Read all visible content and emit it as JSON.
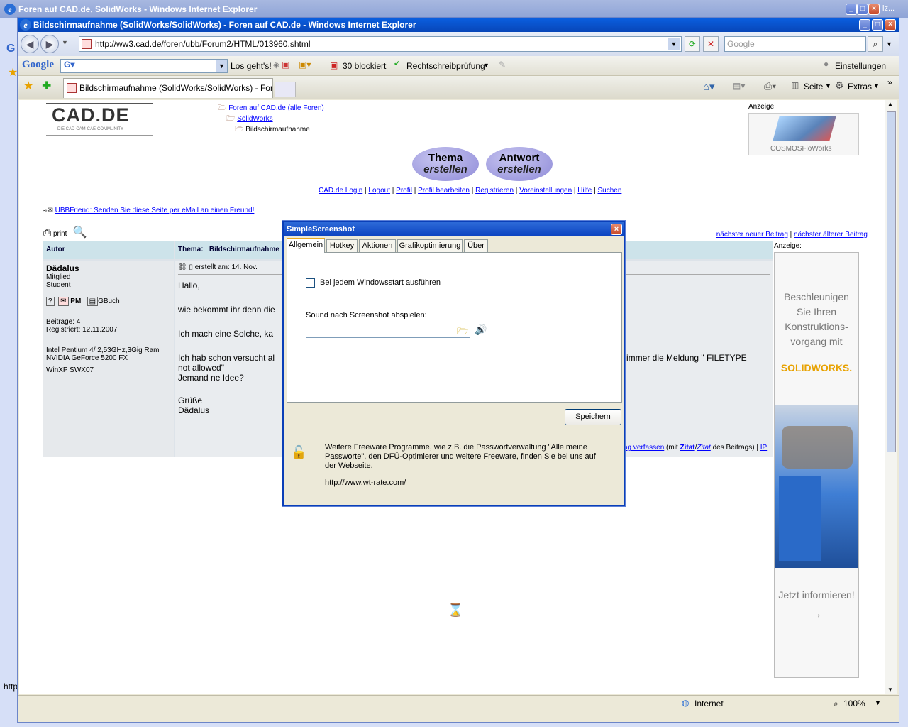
{
  "back_window": {
    "title": "Foren auf CAD.de, SolidWorks - Windows Internet Explorer",
    "side_letter": "G",
    "corner_text": "iz...",
    "left_fragment": "http"
  },
  "window": {
    "title": "Bildschirmaufnahme (SolidWorks/SolidWorks) - Foren auf CAD.de - Windows Internet Explorer"
  },
  "address": {
    "url": "http://ww3.cad.de/foren/ubb/Forum2/HTML/013960.shtml",
    "search_placeholder": "Google"
  },
  "google_toolbar": {
    "brand": "Google",
    "go_label": "Los geht's!",
    "blocked_label": "30 blockiert",
    "spell_label": "Rechtschreibprüfung",
    "settings_label": "Einstellungen"
  },
  "tabs": {
    "active_label": "Bildschirmaufnahme (SolidWorks/SolidWorks) - Foren ..."
  },
  "command_bar": {
    "page_label": "Seite",
    "extras_label": "Extras"
  },
  "status_bar": {
    "zone": "Internet",
    "zoom": "100%"
  },
  "page": {
    "logo_main": "CAD.DE",
    "logo_sub": "DIE CAD-CAM-CAE-COMMUNITY",
    "breadcrumb": {
      "root_link": "Foren auf CAD.de",
      "all_forums": "(alle Foren)",
      "forum": "SolidWorks",
      "current": "Bildschirmaufnahme"
    },
    "ad_label": "Anzeige:",
    "ad_caption": "COSMOSFloWorks",
    "buttons": {
      "new_topic_line1": "Thema",
      "new_topic_line2": "erstellen",
      "reply_line1": "Antwort",
      "reply_line2": "erstellen"
    },
    "nav_links": [
      "CAD.de Login",
      "Logout",
      "Profil",
      "Profil bearbeiten",
      "Registrieren",
      "Voreinstellungen",
      "Hilfe",
      "Suchen"
    ],
    "ubbfriend": "UBBFriend: Senden Sie diese Seite per eMail an einen Freund!",
    "print_label": "print",
    "next_new": "nächster neuer Beitrag",
    "next_old": "nächster älterer Beitrag",
    "table": {
      "autor_header": "Autor",
      "thema_label": "Thema:",
      "thema_value": "Bildschirmaufnahme"
    },
    "author": {
      "name": "Dädalus",
      "role1": "Mitglied",
      "role2": "Student",
      "pm": "PM",
      "gbuch": "GBuch",
      "posts": "Beiträge: 4",
      "registered": "Registriert: 12.11.2007",
      "sys1": "Intel Pentium 4/ 2,53GHz,3Gig Ram",
      "sys2": "NVIDIA GeForce 5200 FX",
      "sys3": "WinXP SWX07"
    },
    "post": {
      "created": "erstellt am: 14. Nov.",
      "l1": "Hallo,",
      "l2": "wie bekommt ihr denn die",
      "l3": "Ich mach eine Solche, ka",
      "l4": "Ich hab schon versucht al",
      "l4_right": "n immer die Meldung \" FILETYPE",
      "l5": "not allowed\"",
      "l6": "Jemand ne Idee?",
      "l7": "Grüße",
      "l8": "Dädalus",
      "footer_link1": "ag verfassen",
      "footer_mid1": "(mit",
      "footer_zitat": "Zitat",
      "footer_zitat2": "Zitat",
      "footer_mid2": "des Beitrags)",
      "footer_ip": "IP"
    },
    "side_ad": {
      "label": "Anzeige:",
      "text1": "Beschleunigen Sie Ihren Konstruktions-vorgang mit",
      "brand": "SOLIDWORKS.",
      "text2": "Jetzt informieren!",
      "arrow": "→"
    }
  },
  "dialog": {
    "title": "SimpleScreenshot",
    "tabs": [
      "Allgemein",
      "Hotkey",
      "Aktionen",
      "Grafikoptimierung",
      "Über"
    ],
    "checkbox_label": "Bei jedem Windowsstart ausführen",
    "sound_label": "Sound nach Screenshot abspielen:",
    "sound_value": "",
    "save_label": "Speichern",
    "info_text": "Weitere Freeware Programme, wie z.B. die Passwortverwaltung \"Alle meine Passworte\", den DFÜ-Optimierer und weitere Freeware, finden Sie bei uns auf der Webseite.",
    "info_url": "http://www.wt-rate.com/"
  },
  "colors": {
    "titlebar": "#0846b8",
    "link": "#0000ff",
    "solidworks": "#e8a200"
  }
}
